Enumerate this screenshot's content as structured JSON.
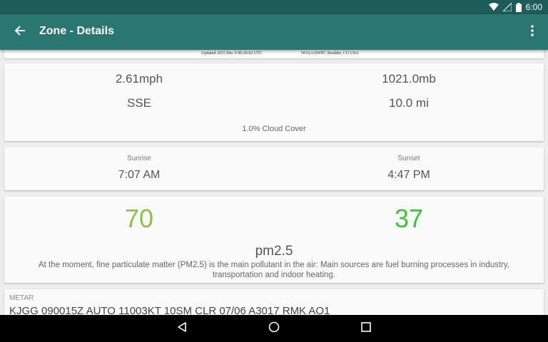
{
  "status_bar": {
    "time": "6:00"
  },
  "app_bar": {
    "title": "Zone - Details"
  },
  "map_strip": {
    "caption_left": "Updated 2015 Dec  9 00:30:02 UTC",
    "caption_right": "NOAA/SWPC Boulder, CO USA"
  },
  "weather": {
    "wind_speed": "2.61mph",
    "pressure": "1021.0mb",
    "wind_direction": "SSE",
    "visibility": "10.0 mi",
    "cloud_cover": "1.0% Cloud Cover"
  },
  "sun": {
    "sunrise_label": "Sunrise",
    "sunrise_time": "7:07 AM",
    "sunset_label": "Sunset",
    "sunset_time": "4:47 PM"
  },
  "air_quality": {
    "value_left": "70",
    "value_left_color": "#8bc34a",
    "value_right": "37",
    "value_right_color": "#3ec436",
    "pollutant": "pm2.5",
    "description": "At the moment, fine particulate matter (PM2.5) is the main pollutant in the air: Main sources are fuel burning processes in industry, transportation and indoor heating."
  },
  "metar": {
    "title": "METAR",
    "text": "KJGG 090015Z AUTO 11003KT 10SM CLR 07/06 A3017 RMK AO1"
  },
  "icons": {
    "back": "arrow-back-icon",
    "menu": "more-vert-icon",
    "nav_back": "triangle-back-icon",
    "nav_home": "circle-home-icon",
    "nav_recents": "square-recents-icon"
  }
}
